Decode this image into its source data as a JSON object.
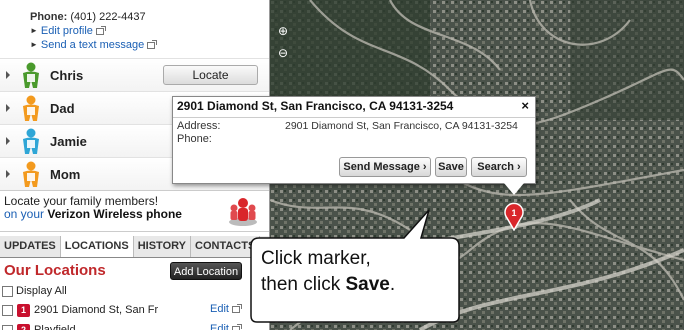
{
  "sidebar": {
    "phone_label": "Phone:",
    "phone_value": "(401) 222-4437",
    "edit_profile": "Edit profile",
    "send_text": "Send a text message",
    "locate_label": "Locate",
    "members": [
      {
        "name": "Chris",
        "color": "#4a9a2c",
        "has_locate": true
      },
      {
        "name": "Dad",
        "color": "#f39a1e",
        "has_locate": false
      },
      {
        "name": "Jamie",
        "color": "#2fa6d6",
        "has_locate": false
      },
      {
        "name": "Mom",
        "color": "#f39a1e",
        "has_locate": false
      }
    ],
    "promo_line1": "Locate your family members!",
    "promo_line2_prefix": "on your",
    "promo_line2_bold": "Verizon Wireless phone",
    "tabs": [
      "UPDATES",
      "LOCATIONS",
      "HISTORY",
      "CONTACTS"
    ],
    "active_tab": "LOCATIONS",
    "locations_title": "Our Locations",
    "add_location": "Add Location",
    "display_all": "Display All",
    "edit_label": "Edit",
    "locations": [
      {
        "num": "1",
        "name": "2901 Diamond St, San Fr"
      },
      {
        "num": "2",
        "name": "Playfield"
      }
    ]
  },
  "map": {
    "zoom_in": "⊕",
    "zoom_out": "⊖",
    "marker_number": "1",
    "popup": {
      "title": "2901 Diamond St, San Francisco, CA 94131-3254",
      "close": "×",
      "address_label": "Address:",
      "address_value": "2901 Diamond St, San Francisco, CA 94131-3254",
      "phone_label": "Phone:",
      "send_message": "Send Message",
      "save": "Save",
      "search": "Search"
    },
    "callout": {
      "line1": "Click marker,",
      "line2_prefix": "then click",
      "line2_bold": "Save",
      "line2_suffix": "."
    }
  },
  "colors": {
    "accent_red": "#c0282b",
    "link_blue": "#1a5fb4",
    "marker_red": "#d9262b"
  }
}
